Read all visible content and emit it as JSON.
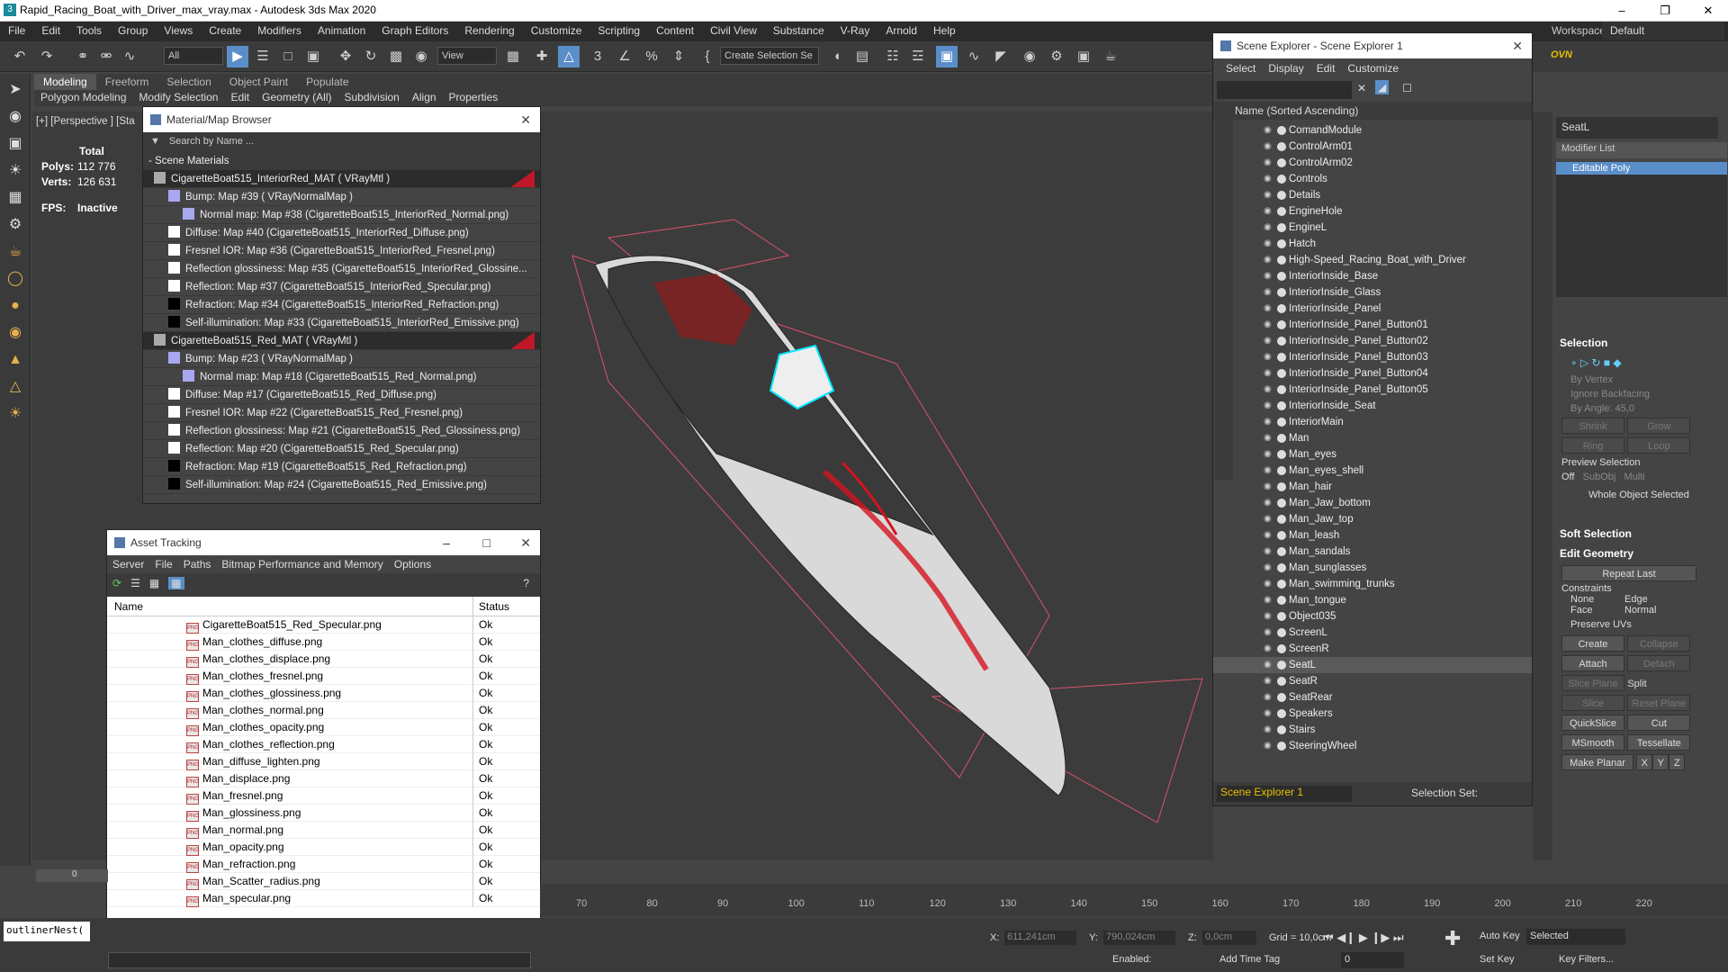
{
  "window": {
    "title": "Rapid_Racing_Boat_with_Driver_max_vray.max - Autodesk 3ds Max 2020",
    "workspaces_label": "Workspaces:",
    "workspace": "Default"
  },
  "menu": [
    "File",
    "Edit",
    "Tools",
    "Group",
    "Views",
    "Create",
    "Modifiers",
    "Animation",
    "Graph Editors",
    "Rendering",
    "Customize",
    "Scripting",
    "Content",
    "Civil View",
    "Substance",
    "V-Ray",
    "Arnold",
    "Help"
  ],
  "toolbar": {
    "filter": "All",
    "view": "View",
    "selection_set": "Create Selection Se"
  },
  "ribbon": {
    "tabs": [
      "Modeling",
      "Freeform",
      "Selection",
      "Object Paint",
      "Populate"
    ],
    "subs": [
      "Polygon Modeling",
      "Modify Selection",
      "Edit",
      "Geometry (All)",
      "Subdivision",
      "Align",
      "Properties"
    ]
  },
  "viewport": {
    "label": "[+] [Perspective ] [Sta",
    "stats": {
      "total": "Total",
      "polys_label": "Polys:",
      "polys": "112 776",
      "verts_label": "Verts:",
      "verts": "126 631",
      "fps_label": "FPS:",
      "fps": "Inactive"
    }
  },
  "material_browser": {
    "title": "Material/Map Browser",
    "search_placeholder": "Search by Name ...",
    "section": "- Scene Materials",
    "rows": [
      {
        "text": "CigaretteBoat515_InteriorRed_MAT  ( VRayMtl )",
        "kind": "mat"
      },
      {
        "text": "Bump: Map #39  ( VRayNormalMap )",
        "kind": "map1"
      },
      {
        "text": "Normal map: Map #38 (CigaretteBoat515_InteriorRed_Normal.png)",
        "kind": "map2"
      },
      {
        "text": "Diffuse: Map #40 (CigaretteBoat515_InteriorRed_Diffuse.png)",
        "kind": "map1"
      },
      {
        "text": "Fresnel IOR: Map #36 (CigaretteBoat515_InteriorRed_Fresnel.png)",
        "kind": "map1"
      },
      {
        "text": "Reflection glossiness: Map #35 (CigaretteBoat515_InteriorRed_Glossine...",
        "kind": "map1"
      },
      {
        "text": "Reflection: Map #37 (CigaretteBoat515_InteriorRed_Specular.png)",
        "kind": "map1"
      },
      {
        "text": "Refraction: Map #34 (CigaretteBoat515_InteriorRed_Refraction.png)",
        "kind": "map1"
      },
      {
        "text": "Self-illumination: Map #33 (CigaretteBoat515_InteriorRed_Emissive.png)",
        "kind": "map1"
      },
      {
        "text": "CigaretteBoat515_Red_MAT  ( VRayMtl )",
        "kind": "mat"
      },
      {
        "text": "Bump: Map #23  ( VRayNormalMap )",
        "kind": "map1"
      },
      {
        "text": "Normal map: Map #18 (CigaretteBoat515_Red_Normal.png)",
        "kind": "map2"
      },
      {
        "text": "Diffuse: Map #17 (CigaretteBoat515_Red_Diffuse.png)",
        "kind": "map1"
      },
      {
        "text": "Fresnel IOR: Map #22 (CigaretteBoat515_Red_Fresnel.png)",
        "kind": "map1"
      },
      {
        "text": "Reflection glossiness: Map #21 (CigaretteBoat515_Red_Glossiness.png)",
        "kind": "map1"
      },
      {
        "text": "Reflection: Map #20 (CigaretteBoat515_Red_Specular.png)",
        "kind": "map1"
      },
      {
        "text": "Refraction: Map #19 (CigaretteBoat515_Red_Refraction.png)",
        "kind": "map1"
      },
      {
        "text": "Self-illumination: Map #24 (CigaretteBoat515_Red_Emissive.png)",
        "kind": "map1"
      }
    ]
  },
  "asset_tracking": {
    "title": "Asset Tracking",
    "menu": [
      "Server",
      "File",
      "Paths",
      "Bitmap Performance and Memory",
      "Options"
    ],
    "col_name": "Name",
    "col_status": "Status",
    "rows": [
      {
        "name": "CigaretteBoat515_Red_Specular.png",
        "status": "Ok"
      },
      {
        "name": "Man_clothes_diffuse.png",
        "status": "Ok"
      },
      {
        "name": "Man_clothes_displace.png",
        "status": "Ok"
      },
      {
        "name": "Man_clothes_fresnel.png",
        "status": "Ok"
      },
      {
        "name": "Man_clothes_glossiness.png",
        "status": "Ok"
      },
      {
        "name": "Man_clothes_normal.png",
        "status": "Ok"
      },
      {
        "name": "Man_clothes_opacity.png",
        "status": "Ok"
      },
      {
        "name": "Man_clothes_reflection.png",
        "status": "Ok"
      },
      {
        "name": "Man_diffuse_lighten.png",
        "status": "Ok"
      },
      {
        "name": "Man_displace.png",
        "status": "Ok"
      },
      {
        "name": "Man_fresnel.png",
        "status": "Ok"
      },
      {
        "name": "Man_glossiness.png",
        "status": "Ok"
      },
      {
        "name": "Man_normal.png",
        "status": "Ok"
      },
      {
        "name": "Man_opacity.png",
        "status": "Ok"
      },
      {
        "name": "Man_refraction.png",
        "status": "Ok"
      },
      {
        "name": "Man_Scatter_radius.png",
        "status": "Ok"
      },
      {
        "name": "Man_specular.png",
        "status": "Ok"
      }
    ]
  },
  "scene_explorer": {
    "title": "Scene Explorer - Scene Explorer 1",
    "menu": [
      "Select",
      "Display",
      "Edit",
      "Customize"
    ],
    "col": "Name (Sorted Ascending)",
    "items": [
      "ComandModule",
      "ControlArm01",
      "ControlArm02",
      "Controls",
      "Details",
      "EngineHole",
      "EngineL",
      "Hatch",
      "High-Speed_Racing_Boat_with_Driver",
      "InteriorInside_Base",
      "InteriorInside_Glass",
      "InteriorInside_Panel",
      "InteriorInside_Panel_Button01",
      "InteriorInside_Panel_Button02",
      "InteriorInside_Panel_Button03",
      "InteriorInside_Panel_Button04",
      "InteriorInside_Panel_Button05",
      "InteriorInside_Seat",
      "InteriorMain",
      "Man",
      "Man_eyes",
      "Man_eyes_shell",
      "Man_hair",
      "Man_Jaw_bottom",
      "Man_Jaw_top",
      "Man_leash",
      "Man_sandals",
      "Man_sunglasses",
      "Man_swimming_trunks",
      "Man_tongue",
      "Object035",
      "ScreenL",
      "ScreenR",
      "SeatL",
      "SeatR",
      "SeatRear",
      "Speakers",
      "Stairs",
      "SteeringWheel"
    ],
    "selected": "SeatL",
    "footer": "Scene Explorer 1",
    "selection_set": "Selection Set:"
  },
  "command_panel": {
    "object_name": "SeatL",
    "modifier_list": "Modifier List",
    "stack_item": "Editable Poly",
    "selection": "Selection",
    "by_vertex": "By Vertex",
    "ignore_backfacing": "Ignore Backfacing",
    "by_angle": "By Angle:",
    "angle": "45,0",
    "shrink": "Shrink",
    "grow": "Grow",
    "ring": "Ring",
    "loop": "Loop",
    "preview": "Preview Selection",
    "off": "Off",
    "subobj": "SubObj",
    "multi": "Multi",
    "whole": "Whole Object Selected",
    "soft": "Soft Selection",
    "edit_geo": "Edit Geometry",
    "repeat": "Repeat Last",
    "constraints": "Constraints",
    "none": "None",
    "edge": "Edge",
    "face": "Face",
    "normal": "Normal",
    "preserve": "Preserve UVs",
    "create": "Create",
    "collapse": "Collapse",
    "attach": "Attach",
    "detach": "Detach",
    "slice_plane": "Slice Plane",
    "split": "Split",
    "slice": "Slice",
    "reset_plane": "Reset Plane",
    "quickslice": "QuickSlice",
    "cut": "Cut",
    "msmooth": "MSmooth",
    "tessellate": "Tessellate",
    "make_planar": "Make Planar",
    "x": "X",
    "y": "Y",
    "z": "Z"
  },
  "timeline": {
    "frame": "0",
    "ticks": [
      "70",
      "80",
      "90",
      "100",
      "110",
      "120",
      "130",
      "140",
      "150",
      "160",
      "170",
      "180",
      "190",
      "200",
      "210",
      "220"
    ]
  },
  "status": {
    "script": "outlinerNest(",
    "x_label": "X:",
    "x": "611,241cm",
    "y_label": "Y:",
    "y": "790,024cm",
    "z_label": "Z:",
    "z": "0,0cm",
    "grid": "Grid = 10,0cm",
    "enabled": "Enabled:",
    "add_time_tag": "Add Time Tag",
    "auto_key": "Auto Key",
    "selected": "Selected",
    "set_key": "Set Key",
    "key_filters": "Key Filters...",
    "frame": "0"
  }
}
